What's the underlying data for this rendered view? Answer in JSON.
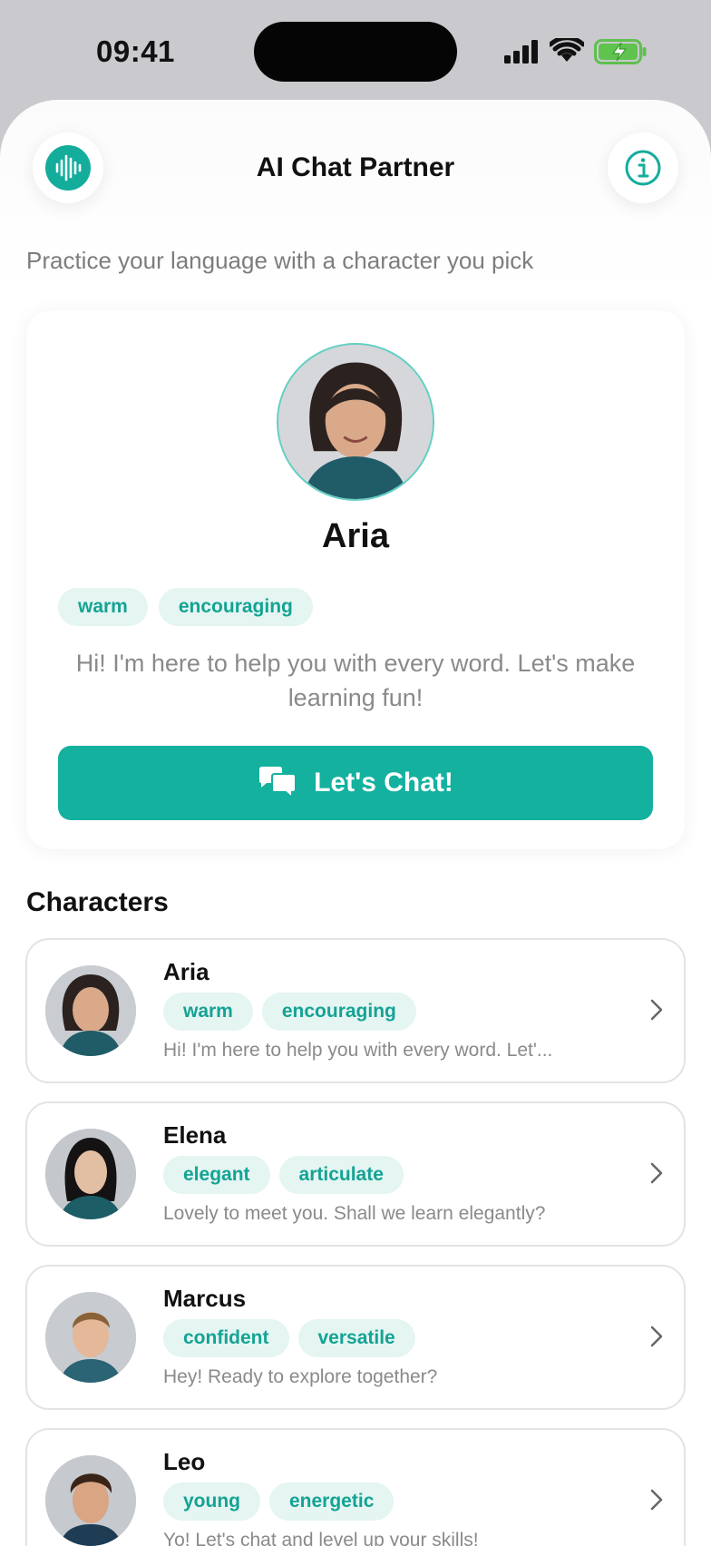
{
  "status_bar": {
    "time": "09:41"
  },
  "header": {
    "title": "AI Chat Partner",
    "logo_icon": "waveform-icon",
    "info_icon": "info-icon"
  },
  "subtitle": "Practice your language with a character you pick",
  "featured": {
    "name": "Aria",
    "tags": [
      "warm",
      "encouraging"
    ],
    "greeting": "Hi! I'm here to help you with every word. Let's make learning fun!",
    "button_label": "Let's Chat!",
    "button_icon": "chat-bubbles-icon"
  },
  "section_title": "Characters",
  "characters": [
    {
      "name": "Aria",
      "tags": [
        "warm",
        "encouraging"
      ],
      "greeting": "Hi! I'm here to help you with every word. Let'..."
    },
    {
      "name": "Elena",
      "tags": [
        "elegant",
        "articulate"
      ],
      "greeting": "Lovely to meet you. Shall we learn elegantly?"
    },
    {
      "name": "Marcus",
      "tags": [
        "confident",
        "versatile"
      ],
      "greeting": "Hey! Ready to explore together?"
    },
    {
      "name": "Leo",
      "tags": [
        "young",
        "energetic"
      ],
      "greeting": "Yo! Let's chat and level up your skills!"
    }
  ],
  "colors": {
    "accent": "#14b19f",
    "tag_bg": "#e4f5f2",
    "tag_text": "#14a394"
  }
}
